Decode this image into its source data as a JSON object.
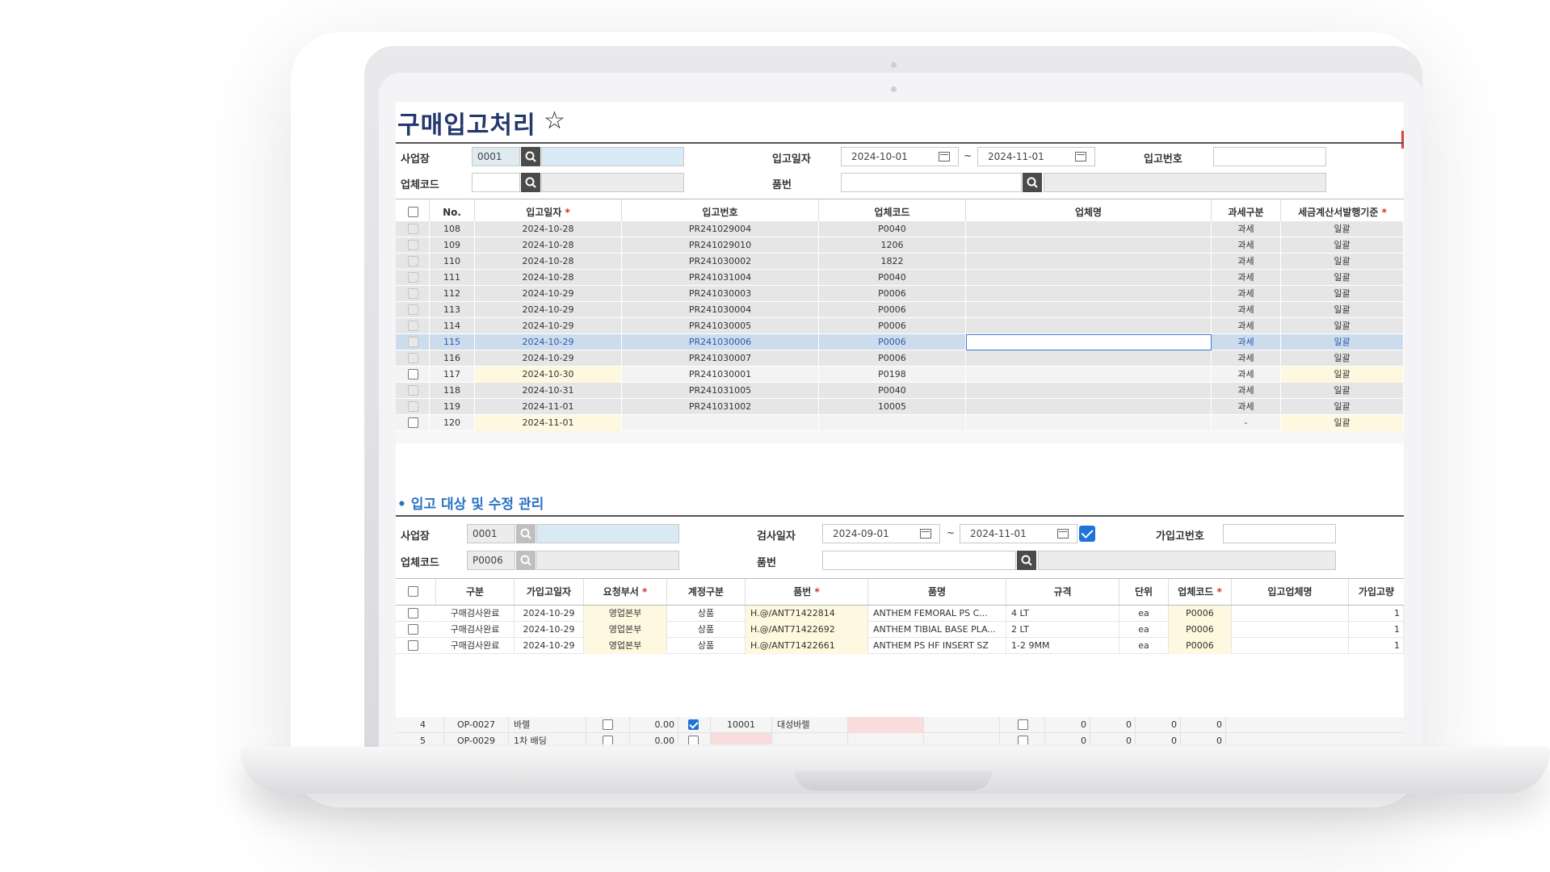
{
  "page": {
    "title": "구매입고처리",
    "star": "☆"
  },
  "filters": {
    "site_label": "사업장",
    "site_code": "0001",
    "receipt_date_label": "입고일자",
    "date_from": "2024-10-01",
    "date_to": "2024-11-01",
    "tilde": "~",
    "receipt_no_label": "입고번호",
    "vendor_label": "업체코드",
    "item_label": "품번"
  },
  "main_grid": {
    "columns": [
      "No.",
      "입고일자",
      "입고번호",
      "업체코드",
      "업체명",
      "과세구분",
      "세금계산서발행기준"
    ],
    "rows": [
      {
        "no": "108",
        "date": "2024-10-28",
        "receipt_no": "PR241029004",
        "vendor": "P0040",
        "name": "",
        "tax": "과세",
        "basis": "일괄",
        "style": "g"
      },
      {
        "no": "109",
        "date": "2024-10-28",
        "receipt_no": "PR241029010",
        "vendor": "1206",
        "name": "",
        "tax": "과세",
        "basis": "일괄",
        "style": "g"
      },
      {
        "no": "110",
        "date": "2024-10-28",
        "receipt_no": "PR241030002",
        "vendor": "1822",
        "name": "",
        "tax": "과세",
        "basis": "일괄",
        "style": "g"
      },
      {
        "no": "111",
        "date": "2024-10-28",
        "receipt_no": "PR241031004",
        "vendor": "P0040",
        "name": "",
        "tax": "과세",
        "basis": "일괄",
        "style": "g"
      },
      {
        "no": "112",
        "date": "2024-10-29",
        "receipt_no": "PR241030003",
        "vendor": "P0006",
        "name": "",
        "tax": "과세",
        "basis": "일괄",
        "style": "g"
      },
      {
        "no": "113",
        "date": "2024-10-29",
        "receipt_no": "PR241030004",
        "vendor": "P0006",
        "name": "",
        "tax": "과세",
        "basis": "일괄",
        "style": "g"
      },
      {
        "no": "114",
        "date": "2024-10-29",
        "receipt_no": "PR241030005",
        "vendor": "P0006",
        "name": "",
        "tax": "과세",
        "basis": "일괄",
        "style": "g"
      },
      {
        "no": "115",
        "date": "2024-10-29",
        "receipt_no": "PR241030006",
        "vendor": "P0006",
        "name": "",
        "tax": "과세",
        "basis": "일괄",
        "style": "sel"
      },
      {
        "no": "116",
        "date": "2024-10-29",
        "receipt_no": "PR241030007",
        "vendor": "P0006",
        "name": "",
        "tax": "과세",
        "basis": "일괄",
        "style": "g"
      },
      {
        "no": "117",
        "date": "2024-10-30",
        "receipt_no": "PR241030001",
        "vendor": "P0198",
        "name": "",
        "tax": "과세",
        "basis": "일괄",
        "style": "w"
      },
      {
        "no": "118",
        "date": "2024-10-31",
        "receipt_no": "PR241031005",
        "vendor": "P0040",
        "name": "",
        "tax": "과세",
        "basis": "일괄",
        "style": "g"
      },
      {
        "no": "119",
        "date": "2024-11-01",
        "receipt_no": "PR241031002",
        "vendor": "10005",
        "name": "",
        "tax": "과세",
        "basis": "일괄",
        "style": "g"
      },
      {
        "no": "120",
        "date": "2024-11-01",
        "receipt_no": "",
        "vendor": "",
        "name": "",
        "tax": "-",
        "basis": "일괄",
        "style": "w"
      }
    ]
  },
  "sub_section": {
    "title": "입고 대상 및 수정 관리",
    "site_label": "사업장",
    "site_code": "0001",
    "inspect_date_label": "검사일자",
    "date_from": "2024-09-01",
    "date_to": "2024-11-01",
    "tilde": "~",
    "temp_no_label": "가입고번호",
    "vendor_label": "업체코드",
    "vendor_code": "P0006",
    "item_label": "품번"
  },
  "sub_grid": {
    "columns": [
      "구분",
      "가입고일자",
      "요청부서",
      "계정구분",
      "품번",
      "품명",
      "규격",
      "단위",
      "업체코드",
      "입고업체명",
      "가입고량"
    ],
    "rows": [
      {
        "type": "구매검사완료",
        "date": "2024-10-29",
        "dept": "영업본부",
        "account": "상품",
        "item_no": "H.@/ANT71422814",
        "item_name": "ANTHEM FEMORAL PS C...",
        "spec": "4 LT",
        "unit": "ea",
        "vendor": "P0006",
        "vendor_name": "",
        "qty": "1"
      },
      {
        "type": "구매검사완료",
        "date": "2024-10-29",
        "dept": "영업본부",
        "account": "상품",
        "item_no": "H.@/ANT71422692",
        "item_name": "ANTHEM TIBIAL BASE PLA...",
        "spec": "2 LT",
        "unit": "ea",
        "vendor": "P0006",
        "vendor_name": "",
        "qty": "1"
      },
      {
        "type": "구매검사완료",
        "date": "2024-10-29",
        "dept": "영업본부",
        "account": "상품",
        "item_no": "H.@/ANT71422661",
        "item_name": "ANTHEM PS HF INSERT SZ",
        "spec": "1-2 9MM",
        "unit": "ea",
        "vendor": "P0006",
        "vendor_name": "",
        "qty": "1"
      }
    ]
  },
  "overlay_grid": {
    "rows": [
      {
        "no": "4",
        "code": "OP-0027",
        "name": "바렐",
        "val1": "0.00",
        "code2": "10001",
        "name2": "대성바렐",
        "n1": "0",
        "n2": "0",
        "n3": "0",
        "n4": "0"
      },
      {
        "no": "5",
        "code": "OP-0029",
        "name": "1차 배딩",
        "val1": "0.00",
        "code2": "",
        "name2": "",
        "n1": "0",
        "n2": "0",
        "n3": "0",
        "n4": "0"
      }
    ]
  }
}
